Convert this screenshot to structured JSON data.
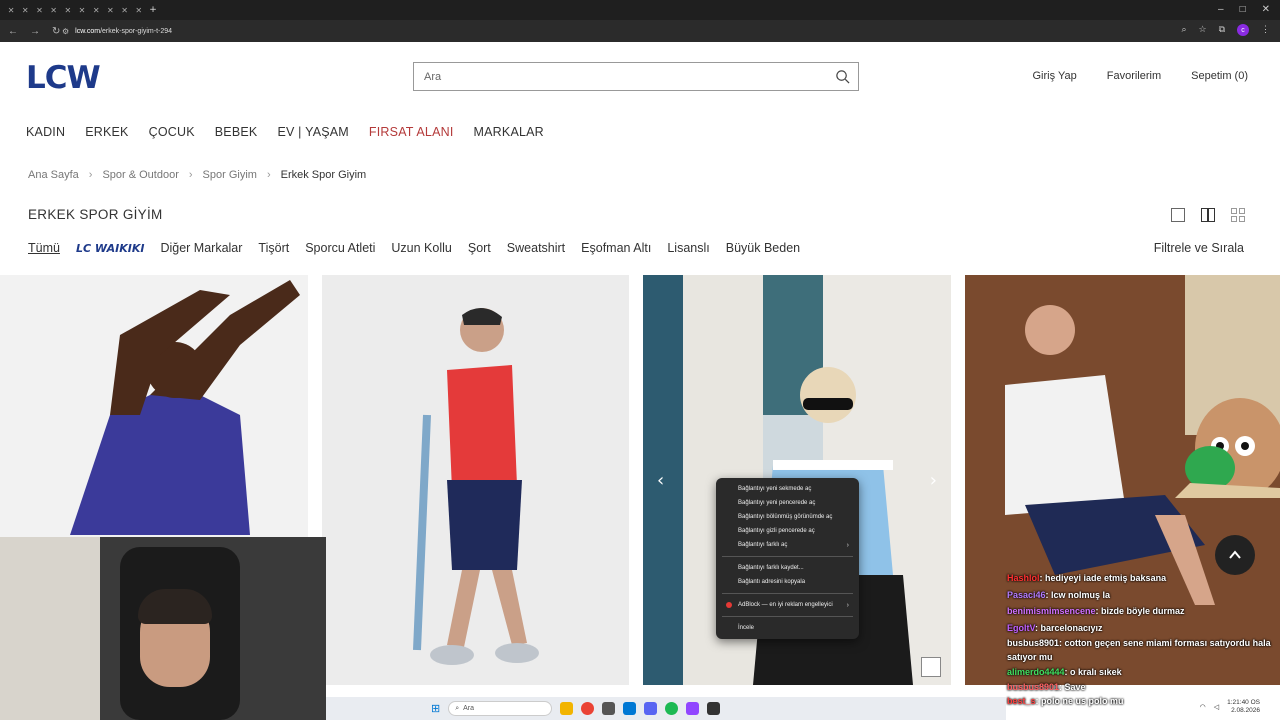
{
  "browser": {
    "url_domain": "lcw.com",
    "url_path": "/erkek-spor-giyim-t-294"
  },
  "header": {
    "logo": "LCW",
    "search_placeholder": "Ara",
    "login": "Giriş Yap",
    "favorites": "Favorilerim",
    "cart": "Sepetim (0)"
  },
  "menu": [
    "KADIN",
    "ERKEK",
    "ÇOCUK",
    "BEBEK",
    "EV | YAŞAM",
    "FIRSAT ALANI",
    "MARKALAR"
  ],
  "breadcrumb": [
    "Ana Sayfa",
    "Spor & Outdoor",
    "Spor Giyim",
    "Erkek Spor Giyim"
  ],
  "page_title": "ERKEK SPOR GİYİM",
  "filters": {
    "all": "Tümü",
    "brand": "LC WAIKIKI",
    "items": [
      "Diğer Markalar",
      "Tişört",
      "Sporcu Atleti",
      "Uzun Kollu",
      "Şort",
      "Sweatshirt",
      "Eşofman Altı",
      "Lisanslı",
      "Büyük Beden"
    ],
    "sort": "Filtrele ve Sırala"
  },
  "context_menu": {
    "items": [
      "Bağlantıyı yeni sekmede aç",
      "Bağlantıyı yeni pencerede aç",
      "Bağlantıyı bölünmüş görünümde aç",
      "Bağlantıyı gizli pencerede aç",
      "Bağlantıyı farklı aç",
      "Bağlantıyı farklı kaydet...",
      "Bağlantı adresini kopyala",
      "AdBlock — en iyi reklam engelleyici",
      "İncele"
    ]
  },
  "taskbar": {
    "search": "Ara",
    "time": "1:21:40 OS",
    "date": "2.08.2026"
  },
  "chat": [
    {
      "user": "Hashlol",
      "msg": ": hediyeyi iade etmiş baksana",
      "color": "#ff3030"
    },
    {
      "user": "Pasaci46",
      "msg": ": lcw nolmuş la",
      "color": "#b47cff"
    },
    {
      "user": "benimismimsencene",
      "msg": ": bizde böyle durmaz",
      "color": "#d070ff"
    },
    {
      "user": "EgoltV",
      "msg": ": barcelonacıyız",
      "color": "#c060ff"
    },
    {
      "user": "busbus8901",
      "msg": ": cotton geçen sene miami forması satıyordu hala satıyor mu",
      "color": "#ffffff"
    },
    {
      "user": "alimerdo4444",
      "msg": ": o kralı sıkek",
      "color": "#40e060"
    },
    {
      "user": "busbus8901",
      "msg": ": Save",
      "color": "#ff6060"
    },
    {
      "user": "best_s",
      "msg": ": polo ne us polo mu",
      "color": "#ff4040"
    }
  ]
}
